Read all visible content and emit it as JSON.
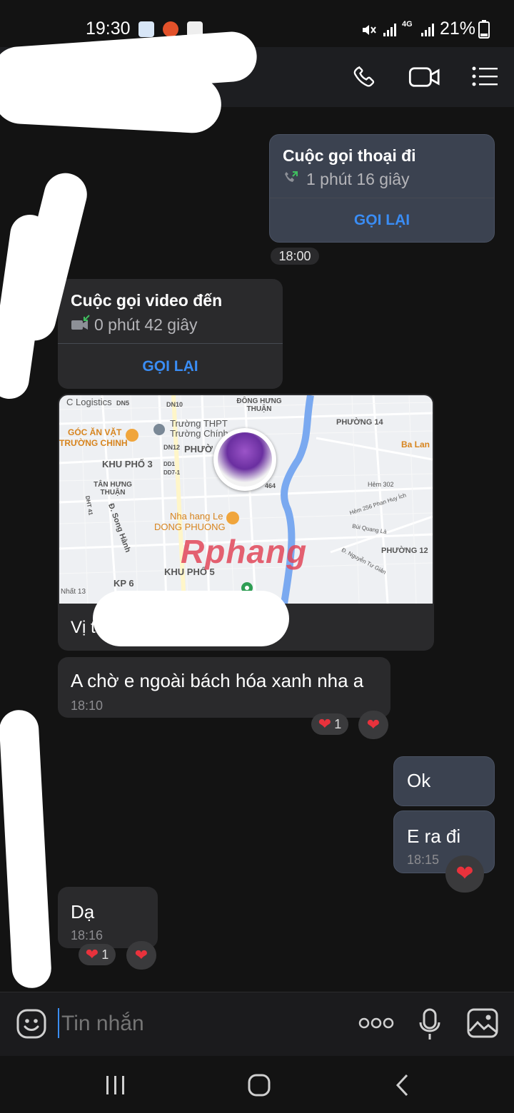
{
  "status_bar": {
    "time": "19:30",
    "battery": "21%",
    "network": "4G"
  },
  "messages": {
    "outgoing_call": {
      "title": "Cuộc gọi thoại đi",
      "duration": "1 phút 16 giây",
      "action": "GỌI LẠI",
      "time": "18:00"
    },
    "incoming_call": {
      "title": "Cuộc gọi video đến",
      "duration": "0 phút 42 giây",
      "action": "GỌI LẠI"
    },
    "location": {
      "caption": "Vị tr",
      "watermark": "Rphang",
      "map_labels": [
        "C Logistics",
        "DN5",
        "DN10",
        "ĐÔNG HƯNG THUẬN",
        "PHƯỜNG 14",
        "Trường THPT",
        "Trường Chính",
        "GÓC ĂN VẶT",
        "TRƯỜNG CHINH",
        "DN12",
        "PHƯỜ",
        "Ba Lan",
        "KHU PHỐ 3",
        "DD1",
        "DD7-1",
        "TÂN HƯNG THUẬN",
        "464",
        "Hẻm 302",
        "Hẻm 256 Phan Huy Ích",
        "Đ. Song Hành",
        "Nha hang Le",
        "DONG PHUONG",
        "Bùi Quang Là",
        "PHƯỜNG 12",
        "Đ. Nguyễn Tư Giản",
        "KHU PHỐ 5",
        "KP 6",
        "Nhất 13",
        "DHT 41"
      ]
    },
    "text1": {
      "text": "A chờ e ngoài bách hóa xanh nha a",
      "time": "18:10",
      "reaction_count": "1"
    },
    "ok": {
      "text": "Ok"
    },
    "era": {
      "text": "E ra đi",
      "time": "18:15"
    },
    "da": {
      "text": "Dạ",
      "time": "18:16",
      "reaction_count": "1"
    }
  },
  "input": {
    "placeholder": "Tin nhắn"
  },
  "colors": {
    "accent": "#3a8df5",
    "heart": "#e8323c",
    "bubble_out": "#3b4250",
    "bubble_in": "#2a2a2c"
  }
}
